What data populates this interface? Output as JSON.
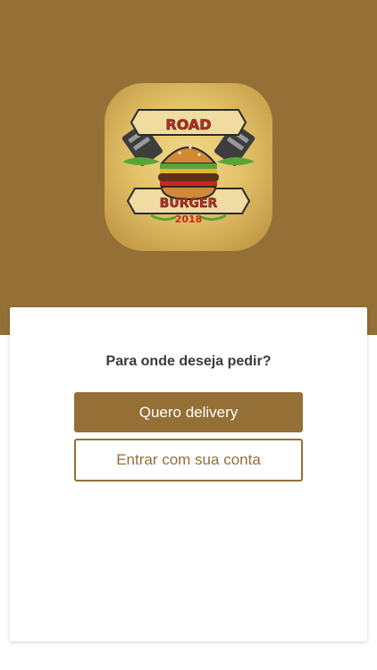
{
  "colors": {
    "brand": "#946f36",
    "card_background": "#ffffff",
    "text_dark": "#3a3a3a",
    "logo_red": "#c8281f",
    "logo_green": "#5aa537"
  },
  "logo": {
    "line1": "ROAD",
    "line2": "BURGER",
    "year": "2018"
  },
  "card": {
    "question": "Para onde deseja pedir?",
    "primary_button": "Quero delivery",
    "secondary_button": "Entrar com sua conta"
  }
}
